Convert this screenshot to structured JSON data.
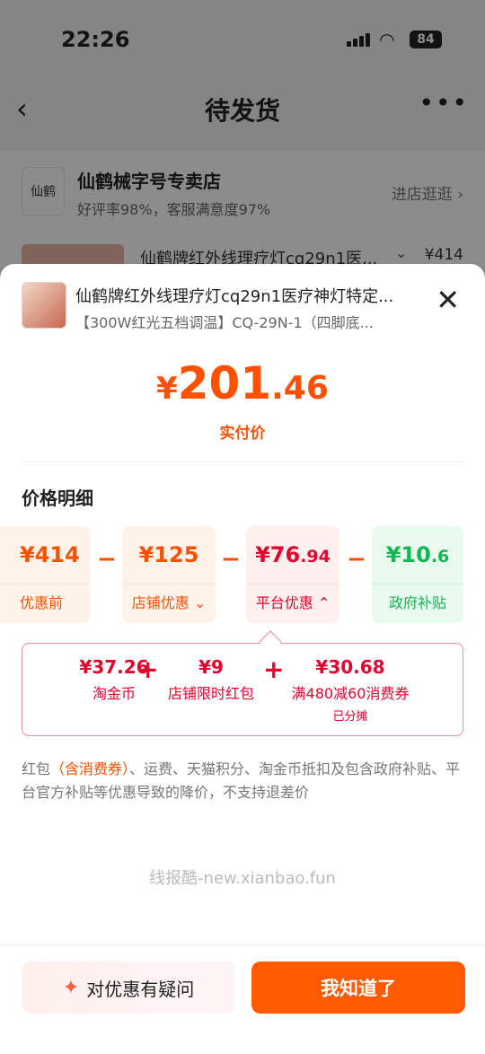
{
  "status": {
    "time": "22:26",
    "battery": "84"
  },
  "nav": {
    "title": "待发货",
    "back_icon": "chevron-left-icon",
    "more_icon": "more-dots-icon"
  },
  "store": {
    "name": "仙鹤械字号专卖店",
    "logo_text": "仙鹤",
    "subtitle": "好评率98%，客服满意度97%",
    "visit": "进店逛逛",
    "item_title": "仙鹤牌红外线理疗灯cq29n1医...",
    "item_price": "¥414"
  },
  "sheet": {
    "product_title": "仙鹤牌红外线理疗灯cq29n1医疗神灯特定...",
    "product_spec": "【300W红光五档调温】CQ-29N-1（四脚底...",
    "price_yen": "¥",
    "price_int": "201",
    "price_dec": ".46",
    "price_caption": "实付价",
    "section_title": "价格明细",
    "boxes": [
      {
        "amount": "¥414",
        "amount_dec": "",
        "label": "优惠前"
      },
      {
        "amount": "¥125",
        "amount_dec": "",
        "label": "店铺优惠",
        "chevron": "⌄"
      },
      {
        "amount": "¥76",
        "amount_dec": ".94",
        "label": "平台优惠",
        "chevron": "⌃"
      },
      {
        "amount": "¥10",
        "amount_dec": ".6",
        "label": "政府补贴"
      }
    ],
    "details": [
      {
        "value": "¥37.26",
        "title": "淘金币",
        "note": ""
      },
      {
        "value": "¥9",
        "title": "店铺限时红包",
        "note": ""
      },
      {
        "value": "¥30.68",
        "title": "满480减60消费券",
        "note": "已分摊"
      }
    ],
    "note_pre": "红包",
    "note_hl": "（含消费券）",
    "note_post": "、运费、天猫积分、淘金币抵扣及包含政府补贴、平台官方补贴等优惠导致的降价，不支持退差价",
    "watermark": "线报酷-new.xianbao.fun",
    "btn_question": "对优惠有疑问",
    "btn_ok": "我知道了"
  },
  "colors": {
    "accent": "#ff5000",
    "red": "#e5002d",
    "green": "#13b652"
  }
}
